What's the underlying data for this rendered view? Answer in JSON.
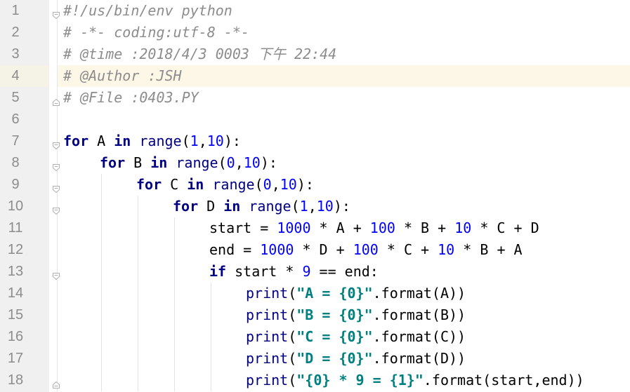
{
  "editor": {
    "colors": {
      "gutter_bg": "#f0f0f0",
      "current_line": "#fcf7e6",
      "comment": "#8c8c8c",
      "keyword": "#000080",
      "number": "#0000ff",
      "string": "#008080"
    },
    "current_line": 4,
    "lines": [
      {
        "n": "1",
        "indent": 0,
        "fold": "open",
        "tokens": [
          {
            "t": "#!/us/bin/env python",
            "c": "comment"
          }
        ]
      },
      {
        "n": "2",
        "indent": 0,
        "fold": "",
        "tokens": [
          {
            "t": "# -*- coding:utf-8 -*-",
            "c": "comment"
          }
        ]
      },
      {
        "n": "3",
        "indent": 0,
        "fold": "",
        "tokens": [
          {
            "t": "# @time :2018/4/3 0003 下午 22:44",
            "c": "comment"
          }
        ]
      },
      {
        "n": "4",
        "indent": 0,
        "fold": "",
        "tokens": [
          {
            "t": "# @Author :JSH",
            "c": "comment"
          }
        ]
      },
      {
        "n": "5",
        "indent": 0,
        "fold": "close",
        "tokens": [
          {
            "t": "# @File :0403.PY",
            "c": "comment"
          }
        ]
      },
      {
        "n": "6",
        "indent": 0,
        "fold": "",
        "tokens": []
      },
      {
        "n": "7",
        "indent": 0,
        "fold": "open",
        "tokens": [
          {
            "t": "for",
            "c": "kw"
          },
          {
            "t": " A ",
            "c": "plain"
          },
          {
            "t": "in",
            "c": "kw"
          },
          {
            "t": " ",
            "c": "plain"
          },
          {
            "t": "range",
            "c": "builtin"
          },
          {
            "t": "(",
            "c": "plain"
          },
          {
            "t": "1",
            "c": "num"
          },
          {
            "t": ",",
            "c": "plain"
          },
          {
            "t": "10",
            "c": "num"
          },
          {
            "t": "):",
            "c": "plain"
          }
        ]
      },
      {
        "n": "8",
        "indent": 1,
        "fold": "open",
        "tokens": [
          {
            "t": "for",
            "c": "kw"
          },
          {
            "t": " B ",
            "c": "plain"
          },
          {
            "t": "in",
            "c": "kw"
          },
          {
            "t": " ",
            "c": "plain"
          },
          {
            "t": "range",
            "c": "builtin"
          },
          {
            "t": "(",
            "c": "plain"
          },
          {
            "t": "0",
            "c": "num"
          },
          {
            "t": ",",
            "c": "plain"
          },
          {
            "t": "10",
            "c": "num"
          },
          {
            "t": "):",
            "c": "plain"
          }
        ]
      },
      {
        "n": "9",
        "indent": 2,
        "fold": "open",
        "tokens": [
          {
            "t": "for",
            "c": "kw"
          },
          {
            "t": " C ",
            "c": "plain"
          },
          {
            "t": "in",
            "c": "kw"
          },
          {
            "t": " ",
            "c": "plain"
          },
          {
            "t": "range",
            "c": "builtin"
          },
          {
            "t": "(",
            "c": "plain"
          },
          {
            "t": "0",
            "c": "num"
          },
          {
            "t": ",",
            "c": "plain"
          },
          {
            "t": "10",
            "c": "num"
          },
          {
            "t": "):",
            "c": "plain"
          }
        ]
      },
      {
        "n": "10",
        "indent": 3,
        "fold": "open",
        "tokens": [
          {
            "t": "for",
            "c": "kw"
          },
          {
            "t": " D ",
            "c": "plain"
          },
          {
            "t": "in",
            "c": "kw"
          },
          {
            "t": " ",
            "c": "plain"
          },
          {
            "t": "range",
            "c": "builtin"
          },
          {
            "t": "(",
            "c": "plain"
          },
          {
            "t": "1",
            "c": "num"
          },
          {
            "t": ",",
            "c": "plain"
          },
          {
            "t": "10",
            "c": "num"
          },
          {
            "t": "):",
            "c": "plain"
          }
        ]
      },
      {
        "n": "11",
        "indent": 4,
        "fold": "",
        "tokens": [
          {
            "t": "start = ",
            "c": "plain"
          },
          {
            "t": "1000",
            "c": "num"
          },
          {
            "t": " * A + ",
            "c": "plain"
          },
          {
            "t": "100",
            "c": "num"
          },
          {
            "t": " * B + ",
            "c": "plain"
          },
          {
            "t": "10",
            "c": "num"
          },
          {
            "t": " * C + D",
            "c": "plain"
          }
        ]
      },
      {
        "n": "12",
        "indent": 4,
        "fold": "",
        "tokens": [
          {
            "t": "end = ",
            "c": "plain"
          },
          {
            "t": "1000",
            "c": "num"
          },
          {
            "t": " * D + ",
            "c": "plain"
          },
          {
            "t": "100",
            "c": "num"
          },
          {
            "t": " * C + ",
            "c": "plain"
          },
          {
            "t": "10",
            "c": "num"
          },
          {
            "t": " * B + A",
            "c": "plain"
          }
        ]
      },
      {
        "n": "13",
        "indent": 4,
        "fold": "open",
        "tokens": [
          {
            "t": "if",
            "c": "kw"
          },
          {
            "t": " start * ",
            "c": "plain"
          },
          {
            "t": "9",
            "c": "num"
          },
          {
            "t": " == end:",
            "c": "plain"
          }
        ]
      },
      {
        "n": "14",
        "indent": 5,
        "fold": "",
        "tokens": [
          {
            "t": "print",
            "c": "builtin"
          },
          {
            "t": "(",
            "c": "plain"
          },
          {
            "t": "\"A = {0}\"",
            "c": "str"
          },
          {
            "t": ".format(A))",
            "c": "plain"
          }
        ]
      },
      {
        "n": "15",
        "indent": 5,
        "fold": "",
        "tokens": [
          {
            "t": "print",
            "c": "builtin"
          },
          {
            "t": "(",
            "c": "plain"
          },
          {
            "t": "\"B = {0}\"",
            "c": "str"
          },
          {
            "t": ".format(B))",
            "c": "plain"
          }
        ]
      },
      {
        "n": "16",
        "indent": 5,
        "fold": "",
        "tokens": [
          {
            "t": "print",
            "c": "builtin"
          },
          {
            "t": "(",
            "c": "plain"
          },
          {
            "t": "\"C = {0}\"",
            "c": "str"
          },
          {
            "t": ".format(C))",
            "c": "plain"
          }
        ]
      },
      {
        "n": "17",
        "indent": 5,
        "fold": "",
        "tokens": [
          {
            "t": "print",
            "c": "builtin"
          },
          {
            "t": "(",
            "c": "plain"
          },
          {
            "t": "\"D = {0}\"",
            "c": "str"
          },
          {
            "t": ".format(D))",
            "c": "plain"
          }
        ]
      },
      {
        "n": "18",
        "indent": 5,
        "fold": "close",
        "tokens": [
          {
            "t": "print",
            "c": "builtin"
          },
          {
            "t": "(",
            "c": "plain"
          },
          {
            "t": "\"{0} * 9 = {1}\"",
            "c": "str"
          },
          {
            "t": ".format(start,end))",
            "c": "plain"
          }
        ]
      }
    ]
  }
}
